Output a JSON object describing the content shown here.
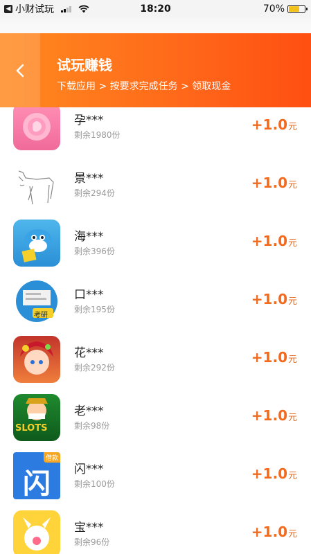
{
  "status_bar": {
    "back_app": "小财试玩",
    "time": "18:20",
    "battery": "70%",
    "battery_level": 0.7
  },
  "header": {
    "title": "试玩赚钱",
    "subtitle": "下载应用 > 按要求完成任务 > 领取现金"
  },
  "items": [
    {
      "name": "孕***",
      "remaining": "剩余1980份",
      "reward": "+1.0",
      "unit": "元",
      "icon": "pregnancy-app-icon"
    },
    {
      "name": "景***",
      "remaining": "剩余294份",
      "reward": "+1.0",
      "unit": "元",
      "icon": "horse-sketch-app-icon"
    },
    {
      "name": "海***",
      "remaining": "剩余396份",
      "reward": "+1.0",
      "unit": "元",
      "icon": "dolphin-app-icon"
    },
    {
      "name": "口***",
      "remaining": "剩余195份",
      "reward": "+1.0",
      "unit": "元",
      "icon": "exam-app-icon",
      "badge": "考研"
    },
    {
      "name": "花***",
      "remaining": "剩余292份",
      "reward": "+1.0",
      "unit": "元",
      "icon": "anime-girl-game-icon"
    },
    {
      "name": "老***",
      "remaining": "剩余98份",
      "reward": "+1.0",
      "unit": "元",
      "icon": "slots-game-icon",
      "badge": "SLOTS"
    },
    {
      "name": "闪***",
      "remaining": "剩余100份",
      "reward": "+1.0",
      "unit": "元",
      "icon": "loan-app-icon",
      "badge": "借款",
      "glyph": "闪"
    },
    {
      "name": "宝***",
      "remaining": "剩余96份",
      "reward": "+1.0",
      "unit": "元",
      "icon": "baby-app-icon"
    }
  ]
}
